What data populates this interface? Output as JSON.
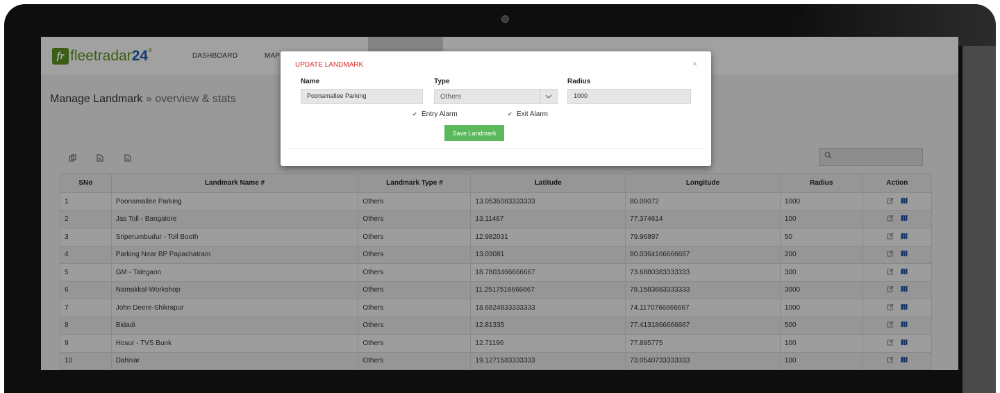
{
  "app": {
    "logo_prefix": "fr",
    "logo_text": "fleetradar",
    "logo_num": "24",
    "logo_reg": "®"
  },
  "nav": {
    "items": [
      "DASHBOARD",
      "MAP"
    ]
  },
  "page": {
    "title": "Manage Landmark",
    "subtitle": "» overview & stats"
  },
  "toolbar": {
    "icons": [
      "copy-icon",
      "excel-icon",
      "pdf-icon"
    ],
    "search_icon": "search-icon",
    "search_placeholder": ""
  },
  "table": {
    "headers": [
      "SNo",
      "Landmark Name #",
      "Landmark Type #",
      "Latitude",
      "Longitude",
      "Radius",
      "Action"
    ],
    "rows": [
      [
        "1",
        "Poonamallee Parking",
        "Others",
        "13.0535083333333",
        "80.09072",
        "1000"
      ],
      [
        "2",
        "Jas Toll - Bangalore",
        "Others",
        "13.11467",
        "77.374614",
        "100"
      ],
      [
        "3",
        "Sriperumbudur - Toll Booth",
        "Others",
        "12.982031",
        "79.96897",
        "50"
      ],
      [
        "4",
        "Parking Near BP Papachatram",
        "Others",
        "13.03081",
        "80.0364166666667",
        "200"
      ],
      [
        "5",
        "GM - Talegaon",
        "Others",
        "18.7803466666667",
        "73.6880383333333",
        "300"
      ],
      [
        "6",
        "Namakkal-Workshop",
        "Others",
        "11.2517516666667",
        "78.1583683333333",
        "3000"
      ],
      [
        "7",
        "John Deere-Shikrapur",
        "Others",
        "18.6824833333333",
        "74.1170766666667",
        "1000"
      ],
      [
        "8",
        "Bidadi",
        "Others",
        "12.81335",
        "77.4131866666667",
        "500"
      ],
      [
        "9",
        "Hosur - TVS Bunk",
        "Others",
        "12.71196",
        "77.895775",
        "100"
      ],
      [
        "10",
        "Dahisar",
        "Others",
        "19.1271583333333",
        "73.0540733333333",
        "100"
      ]
    ]
  },
  "modal": {
    "title": "UPDATE LANDMARK",
    "close": "×",
    "name_label": "Name",
    "name_value": "Poonamallee Parking",
    "type_label": "Type",
    "type_value": "Others",
    "radius_label": "Radius",
    "radius_value": "1000",
    "entry_alarm": "Entry Alarm",
    "exit_alarm": "Exit Alarm",
    "check_glyph": "✔",
    "save_label": "Save Landmark"
  },
  "colors": {
    "brand_green": "#5b8f1f",
    "brand_blue": "#1e5aa8",
    "modal_title": "#e12b2b",
    "save_button": "#5cb85c"
  }
}
